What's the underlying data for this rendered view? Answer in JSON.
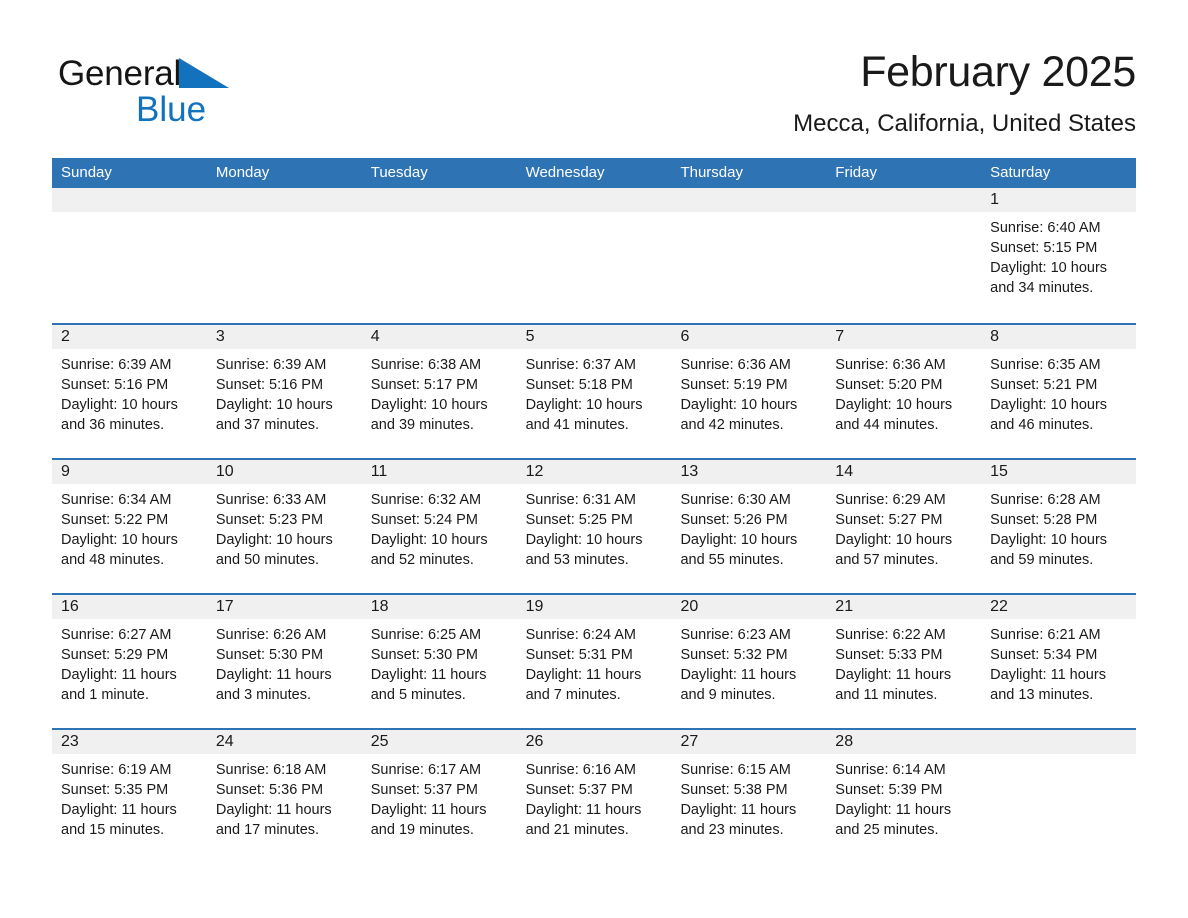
{
  "brand": {
    "name_part1": "General",
    "name_part2": "Blue",
    "triangle_color": "#1272bd"
  },
  "header": {
    "title": "February 2025",
    "subtitle": "Mecca, California, United States"
  },
  "colors": {
    "header_blue": "#2e74b5",
    "row_border_blue": "#2e74b5",
    "daynum_band": "#f0f0f0",
    "text": "#1a1a1a"
  },
  "weekday_headers": [
    "Sunday",
    "Monday",
    "Tuesday",
    "Wednesday",
    "Thursday",
    "Friday",
    "Saturday"
  ],
  "labels": {
    "sunrise_prefix": "Sunrise:",
    "sunset_prefix": "Sunset:",
    "daylight_prefix": "Daylight:"
  },
  "weeks": [
    {
      "days": [
        {
          "empty": true
        },
        {
          "empty": true
        },
        {
          "empty": true
        },
        {
          "empty": true
        },
        {
          "empty": true
        },
        {
          "empty": true
        },
        {
          "day": "1",
          "sunrise": "Sunrise: 6:40 AM",
          "sunset": "Sunset: 5:15 PM",
          "daylight": "Daylight: 10 hours and 34 minutes."
        }
      ]
    },
    {
      "days": [
        {
          "day": "2",
          "sunrise": "Sunrise: 6:39 AM",
          "sunset": "Sunset: 5:16 PM",
          "daylight": "Daylight: 10 hours and 36 minutes."
        },
        {
          "day": "3",
          "sunrise": "Sunrise: 6:39 AM",
          "sunset": "Sunset: 5:16 PM",
          "daylight": "Daylight: 10 hours and 37 minutes."
        },
        {
          "day": "4",
          "sunrise": "Sunrise: 6:38 AM",
          "sunset": "Sunset: 5:17 PM",
          "daylight": "Daylight: 10 hours and 39 minutes."
        },
        {
          "day": "5",
          "sunrise": "Sunrise: 6:37 AM",
          "sunset": "Sunset: 5:18 PM",
          "daylight": "Daylight: 10 hours and 41 minutes."
        },
        {
          "day": "6",
          "sunrise": "Sunrise: 6:36 AM",
          "sunset": "Sunset: 5:19 PM",
          "daylight": "Daylight: 10 hours and 42 minutes."
        },
        {
          "day": "7",
          "sunrise": "Sunrise: 6:36 AM",
          "sunset": "Sunset: 5:20 PM",
          "daylight": "Daylight: 10 hours and 44 minutes."
        },
        {
          "day": "8",
          "sunrise": "Sunrise: 6:35 AM",
          "sunset": "Sunset: 5:21 PM",
          "daylight": "Daylight: 10 hours and 46 minutes."
        }
      ]
    },
    {
      "days": [
        {
          "day": "9",
          "sunrise": "Sunrise: 6:34 AM",
          "sunset": "Sunset: 5:22 PM",
          "daylight": "Daylight: 10 hours and 48 minutes."
        },
        {
          "day": "10",
          "sunrise": "Sunrise: 6:33 AM",
          "sunset": "Sunset: 5:23 PM",
          "daylight": "Daylight: 10 hours and 50 minutes."
        },
        {
          "day": "11",
          "sunrise": "Sunrise: 6:32 AM",
          "sunset": "Sunset: 5:24 PM",
          "daylight": "Daylight: 10 hours and 52 minutes."
        },
        {
          "day": "12",
          "sunrise": "Sunrise: 6:31 AM",
          "sunset": "Sunset: 5:25 PM",
          "daylight": "Daylight: 10 hours and 53 minutes."
        },
        {
          "day": "13",
          "sunrise": "Sunrise: 6:30 AM",
          "sunset": "Sunset: 5:26 PM",
          "daylight": "Daylight: 10 hours and 55 minutes."
        },
        {
          "day": "14",
          "sunrise": "Sunrise: 6:29 AM",
          "sunset": "Sunset: 5:27 PM",
          "daylight": "Daylight: 10 hours and 57 minutes."
        },
        {
          "day": "15",
          "sunrise": "Sunrise: 6:28 AM",
          "sunset": "Sunset: 5:28 PM",
          "daylight": "Daylight: 10 hours and 59 minutes."
        }
      ]
    },
    {
      "days": [
        {
          "day": "16",
          "sunrise": "Sunrise: 6:27 AM",
          "sunset": "Sunset: 5:29 PM",
          "daylight": "Daylight: 11 hours and 1 minute."
        },
        {
          "day": "17",
          "sunrise": "Sunrise: 6:26 AM",
          "sunset": "Sunset: 5:30 PM",
          "daylight": "Daylight: 11 hours and 3 minutes."
        },
        {
          "day": "18",
          "sunrise": "Sunrise: 6:25 AM",
          "sunset": "Sunset: 5:30 PM",
          "daylight": "Daylight: 11 hours and 5 minutes."
        },
        {
          "day": "19",
          "sunrise": "Sunrise: 6:24 AM",
          "sunset": "Sunset: 5:31 PM",
          "daylight": "Daylight: 11 hours and 7 minutes."
        },
        {
          "day": "20",
          "sunrise": "Sunrise: 6:23 AM",
          "sunset": "Sunset: 5:32 PM",
          "daylight": "Daylight: 11 hours and 9 minutes."
        },
        {
          "day": "21",
          "sunrise": "Sunrise: 6:22 AM",
          "sunset": "Sunset: 5:33 PM",
          "daylight": "Daylight: 11 hours and 11 minutes."
        },
        {
          "day": "22",
          "sunrise": "Sunrise: 6:21 AM",
          "sunset": "Sunset: 5:34 PM",
          "daylight": "Daylight: 11 hours and 13 minutes."
        }
      ]
    },
    {
      "days": [
        {
          "day": "23",
          "sunrise": "Sunrise: 6:19 AM",
          "sunset": "Sunset: 5:35 PM",
          "daylight": "Daylight: 11 hours and 15 minutes."
        },
        {
          "day": "24",
          "sunrise": "Sunrise: 6:18 AM",
          "sunset": "Sunset: 5:36 PM",
          "daylight": "Daylight: 11 hours and 17 minutes."
        },
        {
          "day": "25",
          "sunrise": "Sunrise: 6:17 AM",
          "sunset": "Sunset: 5:37 PM",
          "daylight": "Daylight: 11 hours and 19 minutes."
        },
        {
          "day": "26",
          "sunrise": "Sunrise: 6:16 AM",
          "sunset": "Sunset: 5:37 PM",
          "daylight": "Daylight: 11 hours and 21 minutes."
        },
        {
          "day": "27",
          "sunrise": "Sunrise: 6:15 AM",
          "sunset": "Sunset: 5:38 PM",
          "daylight": "Daylight: 11 hours and 23 minutes."
        },
        {
          "day": "28",
          "sunrise": "Sunrise: 6:14 AM",
          "sunset": "Sunset: 5:39 PM",
          "daylight": "Daylight: 11 hours and 25 minutes."
        },
        {
          "empty": true
        }
      ]
    }
  ]
}
